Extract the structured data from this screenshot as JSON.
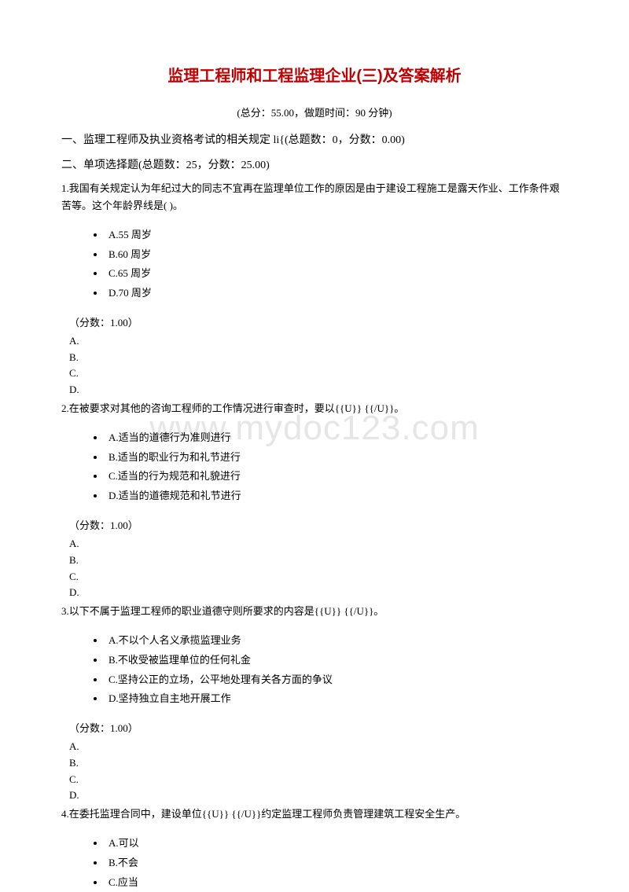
{
  "watermark": "www.mydoc123.com",
  "title": "监理工程师和工程监理企业(三)及答案解析",
  "subtitle": "(总分：55.00，做题时间：90 分钟)",
  "section1": "一、监理工程师及执业资格考试的相关规定 li{(总题数：0，分数：0.00)",
  "section2": "二、单项选择题(总题数：25，分数：25.00)",
  "q1": {
    "text": "1.我国有关规定认为年纪过大的同志不宜再在监理单位工作的原因是由于建设工程施工是露天作业、工作条件艰苦等。这个年龄界线是( )。",
    "opts": [
      "A.55 周岁",
      "B.60 周岁",
      "C.65 周岁",
      "D.70 周岁"
    ],
    "score": "（分数：1.00）",
    "answers": [
      "A.",
      "B.",
      "C.",
      "D."
    ]
  },
  "q2": {
    "text": "2.在被要求对其他的咨询工程师的工作情况进行审查时，要以{{U}}  {{/U}}。",
    "opts": [
      "A.适当的道德行为准则进行",
      "B.适当的职业行为和礼节进行",
      "C.适当的行为规范和礼貌进行",
      "D.适当的道德规范和礼节进行"
    ],
    "score": "（分数：1.00）",
    "answers": [
      "A.",
      "B.",
      "C.",
      "D."
    ]
  },
  "q3": {
    "text": "3.以下不属于监理工程师的职业道德守则所要求的内容是{{U}}  {{/U}}。",
    "opts": [
      "A.不以个人名义承揽监理业务",
      "B.不收受被监理单位的任何礼金",
      "C.坚持公正的立场，公平地处理有关各方面的争议",
      "D.坚持独立自主地开展工作"
    ],
    "score": "（分数：1.00）",
    "answers": [
      "A.",
      "B.",
      "C.",
      "D."
    ]
  },
  "q4": {
    "text": "4.在委托监理合同中，建设单位{{U}}  {{/U}}约定监理工程师负责管理建筑工程安全生产。",
    "opts": [
      "A.可以",
      "B.不会",
      "C.应当"
    ]
  }
}
